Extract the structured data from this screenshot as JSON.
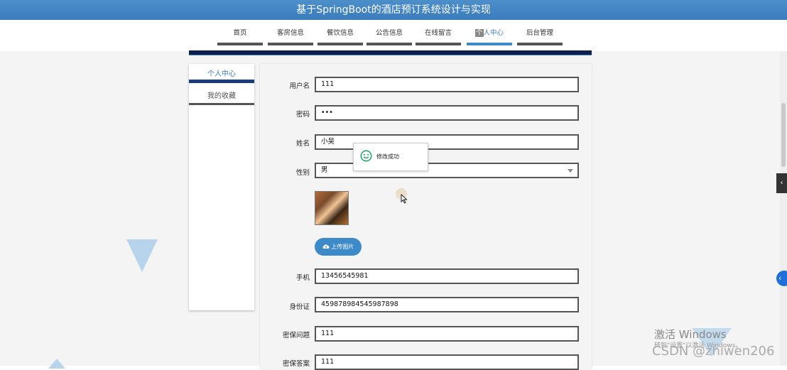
{
  "header": {
    "title": "基于SpringBoot的酒店预订系统设计与实现"
  },
  "nav": {
    "items": [
      "首页",
      "客房信息",
      "餐饮信息",
      "公告信息",
      "在线留言",
      "个人中心",
      "后台管理"
    ],
    "active_prefix": "个",
    "active_rest": "人中心"
  },
  "sidebar": {
    "items": [
      "个人中心",
      "我的收藏"
    ]
  },
  "form": {
    "username_label": "用户名",
    "username_value": "111",
    "password_label": "密码",
    "password_value": "•••",
    "name_label": "姓名",
    "name_value": "小吴",
    "gender_label": "性别",
    "gender_value": "男",
    "upload_label": "上传图片",
    "phone_label": "手机",
    "phone_value": "13456545981",
    "idcard_label": "身份证",
    "idcard_value": "459878984545987898",
    "question_label": "密保问题",
    "question_value": "111",
    "answer_label": "密保答案",
    "answer_value": "111"
  },
  "toast": {
    "message": "修改成功"
  },
  "watermark": {
    "activate": "激活 Windows",
    "activate_sub": "转到\"设置\"以激活 Windows。",
    "csdn": "CSDN @zhiwen206"
  },
  "colors": {
    "primary": "#3d8ac8",
    "header": "#4d8fc9",
    "success": "#1aa260"
  }
}
